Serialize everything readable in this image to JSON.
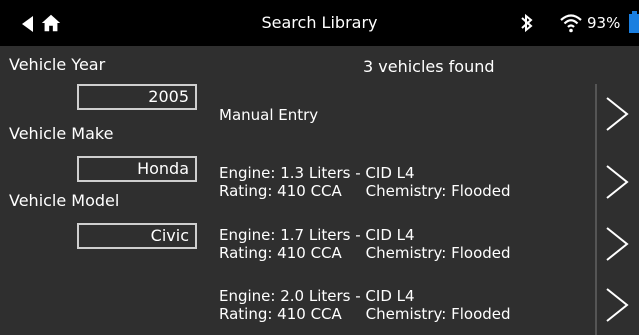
{
  "header": {
    "title": "Search Library",
    "battery_percent": "93%",
    "colors": {
      "bar": "#000000",
      "battery": "#1a7fe0"
    }
  },
  "filters": {
    "year_label": "Vehicle Year",
    "year_value": "2005",
    "make_label": "Vehicle Make",
    "make_value": "Honda",
    "model_label": "Vehicle Model",
    "model_value": "Civic"
  },
  "results": {
    "count_text": "3 vehicles found",
    "items": [
      {
        "line1": "Manual Entry",
        "line2": ""
      },
      {
        "line1": "Engine: 1.3 Liters - CID L4",
        "line2": "Rating: 410 CCA     Chemistry: Flooded"
      },
      {
        "line1": "Engine: 1.7 Liters - CID L4",
        "line2": "Rating: 410 CCA     Chemistry: Flooded"
      },
      {
        "line1": "Engine: 2.0 Liters - CID L4",
        "line2": "Rating: 410 CCA     Chemistry: Flooded"
      }
    ]
  },
  "icons": [
    "back-icon",
    "home-icon",
    "bluetooth-icon",
    "wifi-icon",
    "battery-icon",
    "chevron-right-icon"
  ]
}
